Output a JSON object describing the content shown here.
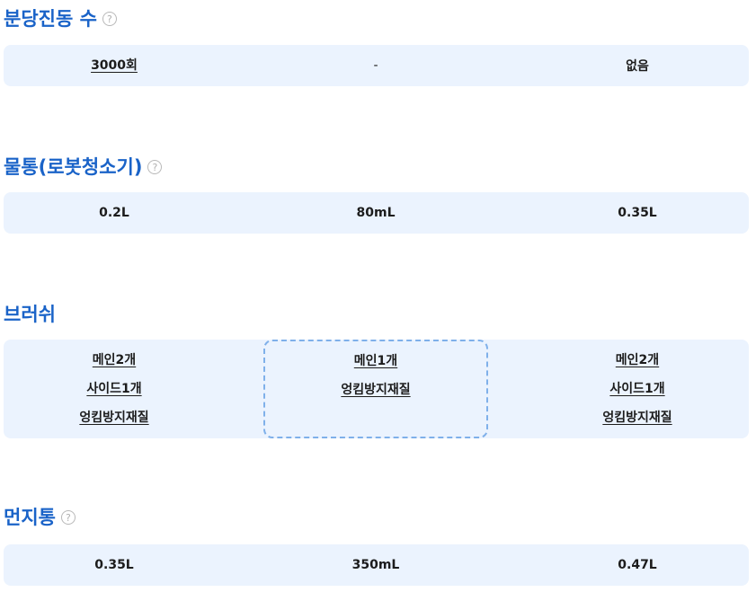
{
  "sections": [
    {
      "title": "분당진동 수",
      "help": "?",
      "cells": [
        "3000회",
        "-",
        "없음"
      ]
    },
    {
      "title": "물통(로봇청소기)",
      "help": "?",
      "cells": [
        "0.2L",
        "80mL",
        "0.35L"
      ]
    },
    {
      "title": "브러쉬",
      "cells": [
        [
          "메인2개",
          "사이드1개",
          "엉킴방지재질"
        ],
        [
          "메인1개",
          "엉킴방지재질"
        ],
        [
          "메인2개",
          "사이드1개",
          "엉킴방지재질"
        ]
      ]
    },
    {
      "title": "먼지통",
      "help": "?",
      "cells": [
        "0.35L",
        "350mL",
        "0.47L"
      ]
    }
  ],
  "colors": {
    "title": "#1a63c8",
    "row_background": "#ebf3fe",
    "highlight_border": "#7fb0ea"
  }
}
